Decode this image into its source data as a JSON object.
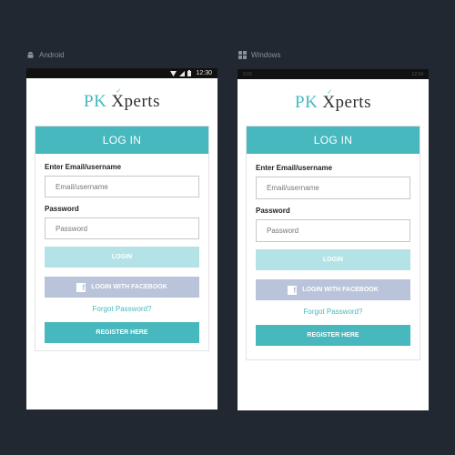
{
  "platforms": {
    "android": {
      "label": "Android",
      "icon": "android-icon"
    },
    "windows": {
      "label": "Windows",
      "icon": "windows-icon"
    }
  },
  "android_status": {
    "time": "12:30"
  },
  "windows_status": {
    "left": "3:15",
    "time": "12:34"
  },
  "brand": {
    "pk": "PK",
    "xperts": "Xperts"
  },
  "login": {
    "title": "LOG IN",
    "email_label": "Enter Email/username",
    "email_placeholder": "Email/username",
    "password_label": "Password",
    "password_placeholder": "Password",
    "login_button": "LOGIN",
    "facebook_button": "LOGIN WITH FACEBOOK",
    "forgot_link": "Forgot Password?",
    "register_button": "REGISTER HERE"
  },
  "colors": {
    "background": "#222831",
    "accent": "#47b8be",
    "login_disabled": "#b3e3e6",
    "facebook": "#b9c3da"
  }
}
